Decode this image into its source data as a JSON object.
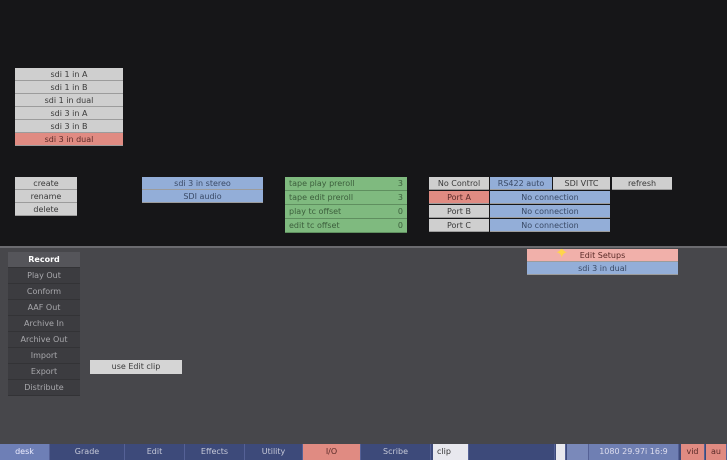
{
  "sources": [
    "sdi 1 in A",
    "sdi 1 in B",
    "sdi 1 in dual",
    "sdi 3 in A",
    "sdi 3 in B",
    "sdi 3 in dual"
  ],
  "commands": [
    "create",
    "rename",
    "delete"
  ],
  "audio": [
    "sdi 3 in stereo",
    "SDI audio"
  ],
  "tape": [
    {
      "label": "tape play preroll",
      "value": "3"
    },
    {
      "label": "tape edit preroll",
      "value": "3"
    },
    {
      "label": "play tc offset",
      "value": "0"
    },
    {
      "label": "edit tc offset",
      "value": "0"
    }
  ],
  "control": {
    "header": [
      "No Control",
      "RS422 auto",
      "SDI VITC",
      "refresh"
    ],
    "ports": [
      {
        "name": "Port A",
        "status": "No connection"
      },
      {
        "name": "Port B",
        "status": "No connection"
      },
      {
        "name": "Port C",
        "status": "No connection"
      }
    ]
  },
  "modes": [
    "Record",
    "Play Out",
    "Conform",
    "AAF Out",
    "Archive In",
    "Archive Out",
    "Import",
    "Export",
    "Distribute"
  ],
  "edit_setups": {
    "title": "Edit Setups",
    "value": "sdi 3 in dual"
  },
  "edit_clip_button": "use Edit clip",
  "toolbar": {
    "desk": "desk",
    "grade": "Grade",
    "edit": "Edit",
    "effects": "Effects",
    "utility": "Utility",
    "io": "I/O",
    "scribe": "Scribe",
    "clip": "clip",
    "format": "1080 29.97i 16:9",
    "vid": "vid",
    "aud": "au"
  }
}
